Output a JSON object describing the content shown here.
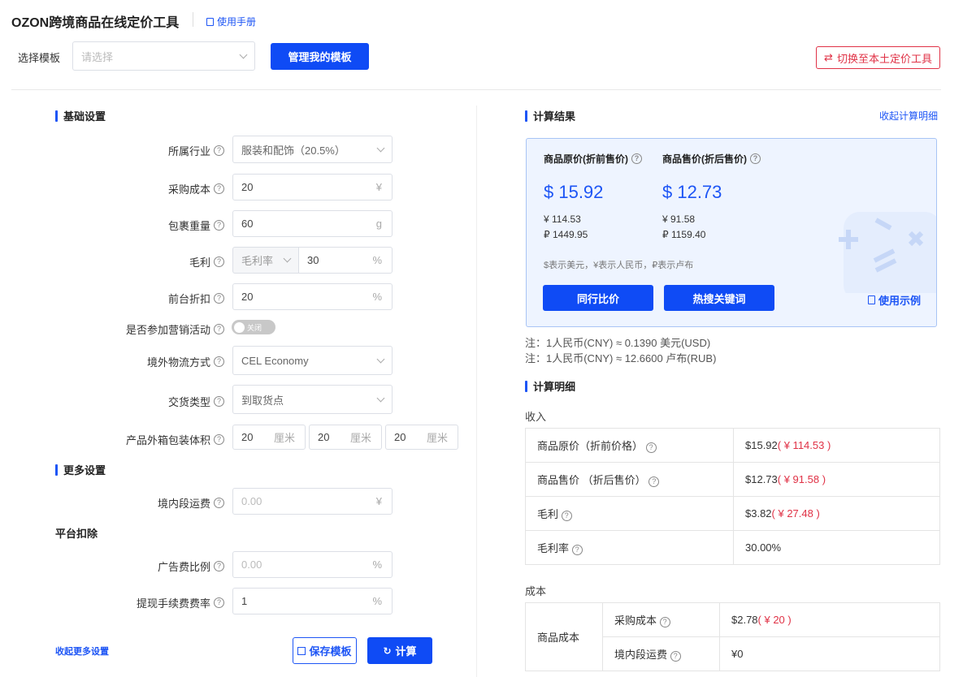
{
  "header": {
    "title": "OZON跨境商品在线定价工具",
    "manual_link": "使用手册",
    "template_label": "选择模板",
    "template_placeholder": "请选择",
    "manage_template_button": "管理我的模板",
    "switch_button": "切换至本土定价工具"
  },
  "basic": {
    "section_title": "基础设置",
    "industry": {
      "label": "所属行业",
      "value": "服装和配饰（20.5%）"
    },
    "purchase_cost": {
      "label": "采购成本",
      "value": "20",
      "unit": "¥"
    },
    "weight": {
      "label": "包裹重量",
      "value": "60",
      "unit": "g"
    },
    "margin": {
      "label": "毛利",
      "mode": "毛利率",
      "value": "30",
      "unit": "%"
    },
    "discount": {
      "label": "前台折扣",
      "value": "20",
      "unit": "%"
    },
    "promo": {
      "label": "是否参加营销活动",
      "toggle_text": "关闭"
    },
    "logistics": {
      "label": "境外物流方式",
      "value": "CEL Economy"
    },
    "delivery": {
      "label": "交货类型",
      "value": "到取货点"
    },
    "volume": {
      "label": "产品外箱包装体积",
      "dims": [
        "20",
        "20",
        "20"
      ],
      "unit": "厘米"
    }
  },
  "more": {
    "section_title": "更多设置",
    "domestic_freight": {
      "label": "境内段运费",
      "placeholder": "0.00",
      "unit": "¥"
    },
    "platform_title": "平台扣除",
    "ad_ratio": {
      "label": "广告费比例",
      "placeholder": "0.00",
      "unit": "%"
    },
    "withdraw_fee": {
      "label": "提现手续费费率",
      "value": "1",
      "unit": "%"
    },
    "collapse_link": "收起更多设置",
    "save_button": "保存模板",
    "calc_button": "计算"
  },
  "result": {
    "section_title": "计算结果",
    "collapse_link": "收起计算明细",
    "original": {
      "label": "商品原价(折前售价)",
      "usd": "$ 15.92",
      "cny": "¥ 114.53",
      "rub": "₽ 1449.95"
    },
    "sale": {
      "label": "商品售价(折后售价)",
      "usd": "$ 12.73",
      "cny": "¥ 91.58",
      "rub": "₽ 1159.40"
    },
    "legend": "$表示美元，¥表示人民币，₽表示卢布",
    "compare_button": "同行比价",
    "hot_button": "热搜关键词",
    "example_link": "使用示例",
    "note1": "注：1人民币(CNY) ≈ 0.1390 美元(USD)",
    "note2": "注：1人民币(CNY) ≈ 12.6600 卢布(RUB)"
  },
  "detail": {
    "section_title": "计算明细",
    "income_label": "收入",
    "income_rows": [
      {
        "label": "商品原价（折前价格）",
        "usd": "$15.92",
        "cny": "( ¥ 114.53 )"
      },
      {
        "label": "商品售价 （折后售价）",
        "usd": "$12.73",
        "cny": "( ¥ 91.58 )"
      },
      {
        "label": "毛利",
        "usd": "$3.82",
        "cny": "( ¥ 27.48 )"
      },
      {
        "label": "毛利率",
        "usd": "30.00%",
        "cny": ""
      }
    ],
    "cost_label": "成本",
    "cost_group": "商品成本",
    "cost_rows": [
      {
        "label": "采购成本",
        "usd": "$2.78",
        "cny": "( ¥ 20 )"
      },
      {
        "label": "境内段运费",
        "usd": "¥0",
        "cny": ""
      }
    ]
  },
  "colors": {
    "primary": "#0f4bf5",
    "accent_red": "#e03246",
    "result_bg": "#eef4ff"
  }
}
